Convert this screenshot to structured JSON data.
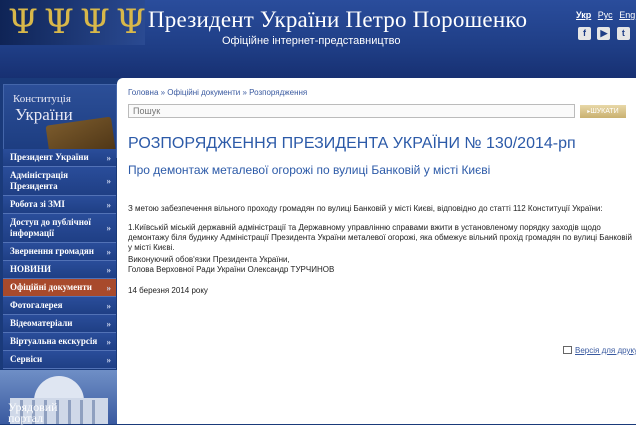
{
  "header": {
    "title": "Президент України Петро Порошенко",
    "subtitle": "Офіційне інтернет-представництво",
    "languages": [
      "Укр",
      "Рус",
      "Eng"
    ],
    "active_language": "Укр",
    "social_icons": [
      "flickr-icon",
      "youtube-icon",
      "twitter-icon"
    ]
  },
  "sidebar": {
    "constitution_small": "Конституція",
    "constitution_big": "України",
    "menu": [
      {
        "label": "Президент України",
        "arrow": "»",
        "active": false
      },
      {
        "label": "Адміністрація Президента",
        "arrow": "»",
        "active": false
      },
      {
        "label": "Робота зі ЗМІ",
        "arrow": "»",
        "active": false
      },
      {
        "label": "Доступ до публічної інформації",
        "arrow": "»",
        "active": false
      },
      {
        "label": "Звернення громадян",
        "arrow": "»",
        "active": false
      },
      {
        "label": "НОВИНИ",
        "arrow": "»",
        "active": false
      },
      {
        "label": "Офіційні документи",
        "arrow": "»",
        "active": true
      },
      {
        "label": "Фотогалерея",
        "arrow": "»",
        "active": false
      },
      {
        "label": "Відеоматеріали",
        "arrow": "»",
        "active": false
      },
      {
        "label": "Віртуальна екскурсія",
        "arrow": "»",
        "active": false
      },
      {
        "label": "Сервіси",
        "arrow": "»",
        "active": false
      }
    ],
    "portal_line1": "Урядовий",
    "portal_line2": "портал"
  },
  "content": {
    "breadcrumb": "Головна » Офіційні документи » Розпорядження",
    "search_placeholder": "Пошук",
    "search_button": "ШУКАТИ",
    "title": "РОЗПОРЯДЖЕННЯ ПРЕЗИДЕНТА УКРАЇНИ № 130/2014-рп",
    "subtitle": "Про демонтаж металевої огорожі по вулиці Банковій у місті Києві",
    "intro": "З метою забезпечення вільного проходу громадян по вулиці Банковій у місті Києві, відповідно до статті 112 Конституції України:",
    "point1": "1.Київській міській державній адміністрації та Державному управлінню справами вжити в установленому порядку заходів щодо демонтажу біля будинку Адміністрації Президента України металевої огорожі, яка обмежує вільний прохід громадян по вулиці Банковій у місті Києві.",
    "sign_line1": "Виконуючий обов'язки Президента України,",
    "sign_line2": "Голова Верховної Ради України Олександр ТУРЧИНОВ",
    "date": "14 березня 2014 року",
    "print_link": "Версія для друку"
  }
}
